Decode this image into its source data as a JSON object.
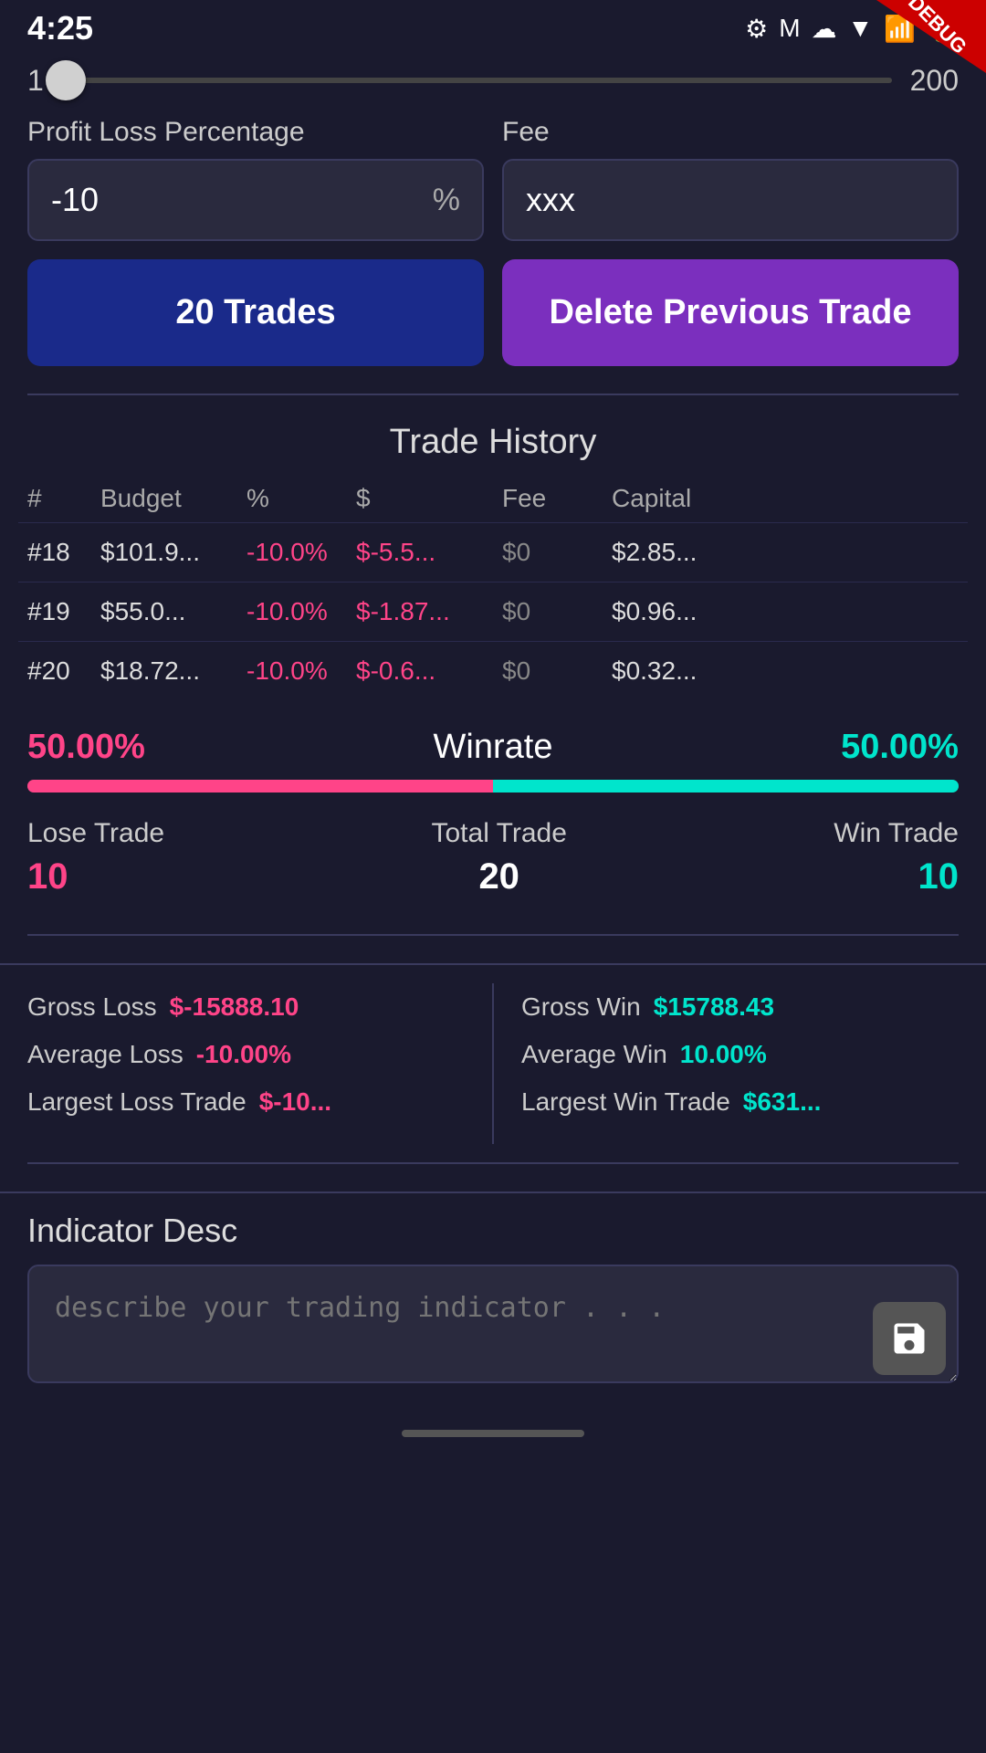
{
  "statusBar": {
    "time": "4:25",
    "icons": [
      "⚙",
      "M",
      "☁",
      "▼",
      "📶",
      "🔋"
    ],
    "debugLabel": "DEBUG"
  },
  "slider": {
    "min": "1",
    "max": "200",
    "value": 1
  },
  "form": {
    "profitLossLabel": "Profit Loss Percentage",
    "feeLabel": "Fee",
    "profitLossValue": "-10",
    "profitLossSuffix": "%",
    "feeValue": "xxx"
  },
  "buttons": {
    "tradesLabel": "20 Trades",
    "deleteLabel": "Delete Previous Trade"
  },
  "tradeHistory": {
    "sectionTitle": "Trade History",
    "columns": [
      "#",
      "Budget",
      "%",
      "$",
      "Fee",
      "Capital"
    ],
    "rows": [
      {
        "num": "#18",
        "budget": "$101.9...",
        "pct": "-10.0%",
        "dollar": "$-5.5...",
        "fee": "$0",
        "capital": "$2.85..."
      },
      {
        "num": "#19",
        "budget": "$55.0...",
        "pct": "-10.0%",
        "dollar": "$-1.87...",
        "fee": "$0",
        "capital": "$0.96..."
      },
      {
        "num": "#20",
        "budget": "$18.72...",
        "pct": "-10.0%",
        "dollar": "$-0.6...",
        "fee": "$0",
        "capital": "$0.32..."
      }
    ]
  },
  "winrate": {
    "label": "Winrate",
    "lossPct": "50.00%",
    "winPct": "50.00%",
    "progressLoss": 50,
    "progressWin": 50,
    "lossTrade": {
      "label": "Lose Trade",
      "value": "10"
    },
    "totalTrade": {
      "label": "Total Trade",
      "value": "20"
    },
    "winTrade": {
      "label": "Win Trade",
      "value": "10"
    }
  },
  "financial": {
    "grossLossLabel": "Gross Loss",
    "grossLossValue": "$-15888.10",
    "avgLossLabel": "Average Loss",
    "avgLossValue": "-10.00%",
    "largestLossLabel": "Largest Loss Trade",
    "largestLossValue": "$-10...",
    "grossWinLabel": "Gross Win",
    "grossWinValue": "$15788.43",
    "avgWinLabel": "Average Win",
    "avgWinValue": "10.00%",
    "largestWinLabel": "Largest Win Trade",
    "largestWinValue": "$631..."
  },
  "indicator": {
    "label": "Indicator Desc",
    "placeholder": "describe your trading indicator . . .",
    "saveIconLabel": "save-icon"
  }
}
